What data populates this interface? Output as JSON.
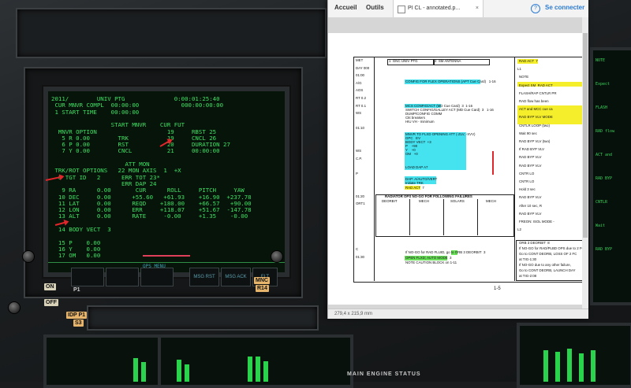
{
  "crt": {
    "lines": [
      "2011/        UNIV PTG              0:00:01:25:40",
      " CUR MNVR COMPL  00:00:00            000:00:00:00",
      " 1 START TIME    00:00:00",
      "",
      "                 START MNVR    CUR FUT",
      "  MNVR OPTION                    19     RBST 25",
      "   5 R 0.00        TRK           19     CNCL 26",
      "   6 P 0.00        RST           20     DURATION 27",
      "   7 Y 0.00        CNCL          21     00:00:00",
      "",
      "                     ATT MON",
      " TRK/ROT OPTIONS   22 MON AXIS  1  +X",
      "  8 TGT ID   2      ERR TOT 23*",
      "                    ERR DAP 24",
      "   9 RA      0.00       CUR      ROLL     PITCH     YAW",
      "  10 DEC     0.00      +55.60   +61.93    +16.90  +237.78",
      "  11 LAT     0.00      REQD    +180.00    +66.57   +90.00",
      "  12 LON     0.00      ERR     +118.07    +51.67  -147.78",
      "  13 ALT     0.00      RATE     -0.00     +1.35    -0.00",
      "",
      "  14 BODY VECT  3",
      "",
      "  15 P    0.00",
      "  16 Y    0.00",
      "  17 OM   0.00"
    ],
    "footer_label": "OPS MENU"
  },
  "bezel_buttons": [
    "",
    "",
    "",
    "MSG RST",
    "MSG ACK",
    "FLT"
  ],
  "side_labels": {
    "left_top": "ON",
    "left_mid": "OFF",
    "p1": "P1",
    "idp": "IDP P1",
    "s3": "S3",
    "mdu": "MNC",
    "r14": "R14"
  },
  "right_panel_lines": [
    "NOTE",
    "Expect",
    "FLASH",
    "RAD flow",
    "ACT and",
    "RAD BYP",
    "CNTLR",
    "Wait",
    "RAD BYP"
  ],
  "engine_status_label": "MAIN ENGINE STATUS",
  "viewer": {
    "tabs": {
      "home": "Accueil",
      "tools": "Outils",
      "doc": "PI CL - annotated.p...",
      "close": "×"
    },
    "help": "?",
    "connect": "Se connecter",
    "status": "279,4 x 215,9 mm",
    "page_number": "1-5"
  },
  "checklist": {
    "col_left": [
      "MET",
      "DAY 000",
      "01:00",
      "A/G",
      "AOS",
      "RT 0.2",
      "RT 0.1",
      "WS",
      "",
      "01:10",
      "",
      "",
      "WS",
      "C.P.",
      "",
      "P",
      "",
      "",
      "01:20",
      "ORT1",
      "",
      "",
      "",
      "",
      "",
      "C",
      "01:30"
    ],
    "header_cells": [
      "1  GNC UNIV PTG",
      "2  SM ANTENNA"
    ],
    "steps": [
      "CONFIG FOR FLEX OPERATIONS (APT Cue Card)   1-16",
      "MCS CONFIG/ACT (MD Cue Card)  3  1-16",
      "SWITCH CONFIG/GALLEY ACT (MD Cue Card)  3   1-16",
      "DUMP/CONFIG COMM",
      "Ckt breakers",
      "HIU VH - minimum",
      "MNVR TO FLXD OPENING ATT (-ZLV, -XVV)",
      "GPC   EV",
      "BODY VECT  +3",
      "P    +90",
      "Y    +0",
      "OM   +0",
      "LOAD DAP A7",
      "DAP: A/AUTO/VERT",
      "Initiate TRK",
      "RAD ACT  7",
      "RADIATOR OPS NO-GO FOR FOLLOWING FAILURES",
      "If NO-GO for RAD FLUID, go to ORB 3 DEORBIT  3",
      "OPEN FLXD; AUTO MODE  3",
      "NOTE CAUTION BLOCK on 1-11"
    ],
    "failure_headers": [
      "DEORBIT",
      "MECH",
      "SOLARS",
      "MECH"
    ],
    "right_col": [
      "RAD ACT  7",
      "L1",
      "NOTE",
      "Expect SM  RAD ACT",
      "FLASH/RAP CNTLR PR",
      "RAD flow has been",
      "ACT and MCC cue ca",
      "RAD BYP VLV MODE",
      "CNTLR LOOP (two)",
      "Wait 90 sec",
      "RAD BYP VLV (two)",
      "If RAD BYP VLV",
      "RAD BYP VLV",
      "RAD BYP VLV",
      "CNTR LO",
      "CNTR LO",
      "Hold 3 sec",
      "RAD BYP VLV",
      "After 10 sec, R",
      "RAD BYP VLV",
      "FREON: ISOL MODE -",
      "L2",
      "ORB 3 DEORBIT  8",
      "If NO-GO for RAD/PLBD OPS due to 2 FC",
      "Go to CONT DEORB, LOSS OF 2 FC",
      "at TIG-1:30",
      "If NO-GO due to any other failure,",
      "Go to CONT DEORB, LAUNCH DAY",
      "at TIG-2:08"
    ]
  },
  "colors": {
    "crt_green": "#3fe063",
    "annotation_red": "#e0262a",
    "highlight_cyan": "#45e2f0",
    "highlight_yellow": "#f5ef2b",
    "highlight_green": "#6be05a",
    "link_blue": "#2c7bd3"
  }
}
